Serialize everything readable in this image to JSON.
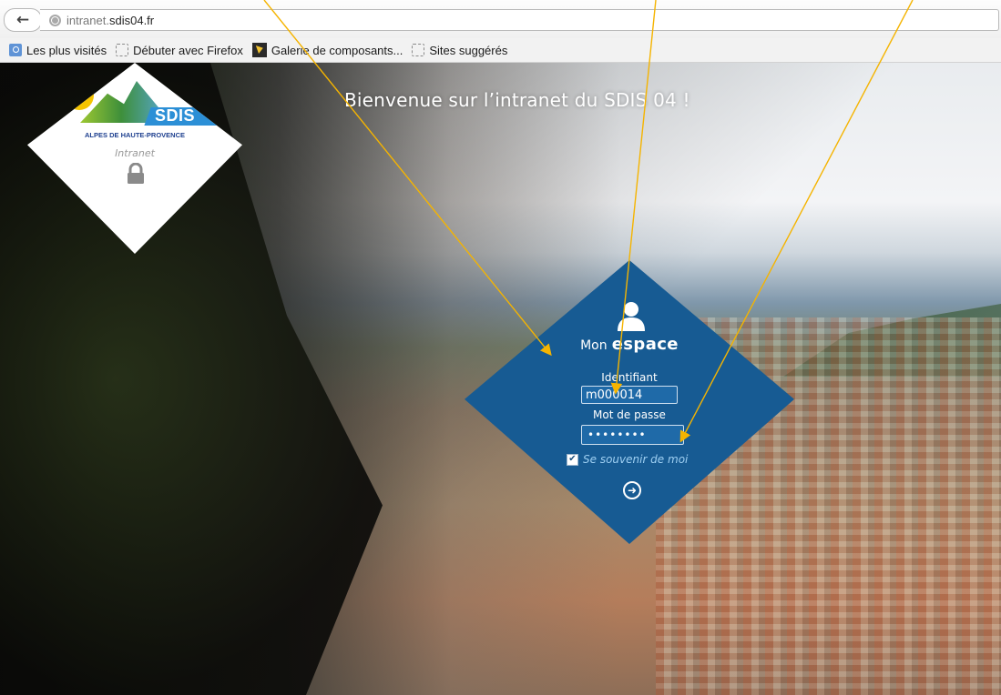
{
  "browser": {
    "url_prefix": "intranet.",
    "url_domain": "sdis04.fr",
    "bookmarks": [
      {
        "label": "Les plus visités",
        "icon": "most-visited-icon"
      },
      {
        "label": "Débuter avec Firefox",
        "icon": "bookmark-icon"
      },
      {
        "label": "Galerie de composants...",
        "icon": "gallery-icon"
      },
      {
        "label": "Sites suggérés",
        "icon": "bookmark-icon"
      }
    ]
  },
  "page": {
    "welcome": "Bienvenue sur l’intranet du SDIS 04 !",
    "logo": {
      "name": "SDIS",
      "region": "ALPES DE HAUTE-PROVENCE",
      "subtitle": "Intranet",
      "icon": "lock-icon"
    },
    "login": {
      "title_small": "Mon",
      "title_big": "espace",
      "id_label": "Identifiant",
      "id_value": "m000014",
      "pw_label": "Mot de passe",
      "pw_value": "••••••••",
      "remember_label": "Se souvenir de moi",
      "remember_checked": true,
      "submit_icon": "arrow-circle-right-icon"
    }
  },
  "colors": {
    "login_bg": "#175b93",
    "remember_text": "#9fd0f3",
    "arrow": "#f5b400"
  }
}
